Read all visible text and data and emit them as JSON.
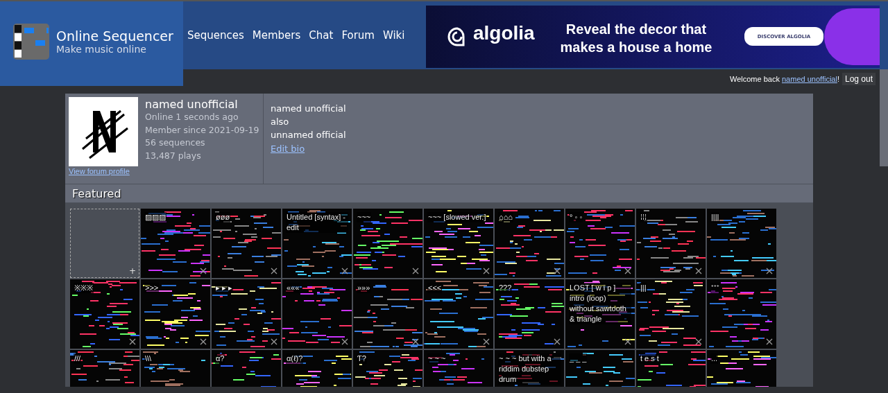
{
  "site": {
    "title": "Online Sequencer",
    "tagline": "Make music online"
  },
  "nav": [
    "Sequences",
    "Members",
    "Chat",
    "Forum",
    "Wiki"
  ],
  "ad": {
    "brand": "algolia",
    "headline": "Reveal the decor that makes a house a home",
    "button": "DISCOVER ALGOLIA"
  },
  "user_bar": {
    "greeting": "Welcome back ",
    "username": "named unofficial",
    "suffix": "!",
    "logout": "Log out"
  },
  "profile": {
    "name": "named unofficial",
    "stats": [
      "Online 1 seconds ago",
      "Member since 2021-09-19",
      "56 sequences",
      "13,487 plays"
    ],
    "forum_link": "View forum profile",
    "bio": [
      "named unofficial",
      "also",
      "unnamed official"
    ],
    "edit_bio": "Edit bio"
  },
  "featured": {
    "title": "Featured",
    "tiles": [
      {
        "kind": "add",
        "label": "+"
      },
      {
        "kind": "sequence",
        "title": "▨▨▨",
        "removable": true
      },
      {
        "kind": "sequence",
        "title": "øøø",
        "removable": true
      },
      {
        "kind": "sequence",
        "title": "Untitled [syntax] - edit",
        "removable": true
      },
      {
        "kind": "sequence",
        "title": "~~~",
        "removable": true
      },
      {
        "kind": "sequence",
        "title": "~~~ [slowed ver.]",
        "removable": true
      },
      {
        "kind": "sequence",
        "title": "⌂⌂⌂",
        "removable": true
      },
      {
        "kind": "sequence",
        "title": "° ◦ ◦",
        "removable": true
      },
      {
        "kind": "sequence",
        "title": "⁞⁞⁞",
        "removable": true
      },
      {
        "kind": "sequence",
        "title": "||||",
        "removable": true
      },
      {
        "kind": "sequence",
        "title": "※※※",
        "removable": true
      },
      {
        "kind": "sequence",
        "title": ">>>",
        "removable": true
      },
      {
        "kind": "sequence",
        "title": "▸ ▸ ▸",
        "removable": true
      },
      {
        "kind": "sequence",
        "title": "«««",
        "removable": true
      },
      {
        "kind": "sequence",
        "title": "»»»",
        "removable": true
      },
      {
        "kind": "sequence",
        "title": "<<<",
        "removable": true
      },
      {
        "kind": "sequence",
        "title": "???",
        "removable": true
      },
      {
        "kind": "sequence",
        "title": "LOST [ w i p ] intro (loop) without sawtooth & triangle",
        "removable": true
      },
      {
        "kind": "sequence",
        "title": "|||",
        "removable": true
      },
      {
        "kind": "sequence",
        "title": "⁺⁺⁺",
        "removable": true
      },
      {
        "kind": "sequence",
        "title": "///"
      },
      {
        "kind": "sequence",
        "title": "\\\\\\"
      },
      {
        "kind": "sequence",
        "title": "α?"
      },
      {
        "kind": "sequence",
        "title": "α(ℓ)?"
      },
      {
        "kind": "sequence",
        "title": "Ƭ?"
      },
      {
        "kind": "sequence",
        "title": "~ ~ ~"
      },
      {
        "kind": "sequence",
        "title": "~ ~ ~ but with a riddim dubstep drum"
      },
      {
        "kind": "sequence",
        "title": "_ _ _"
      },
      {
        "kind": "sequence",
        "title": "t e s t"
      },
      {
        "kind": "sequence",
        "title": "..."
      }
    ]
  }
}
